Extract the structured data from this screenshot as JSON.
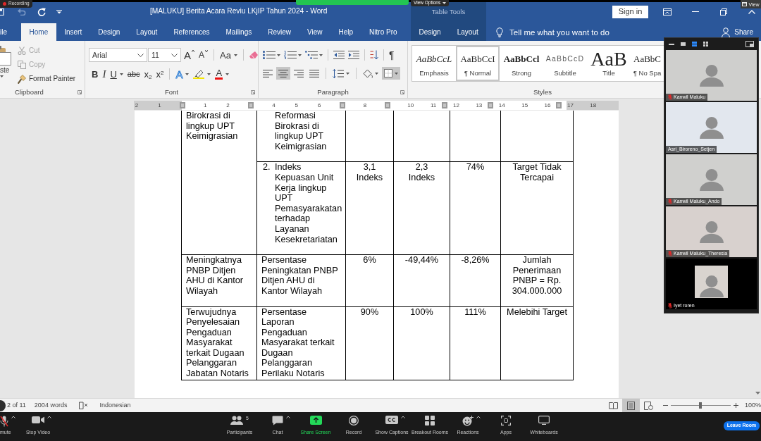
{
  "overlays": {
    "recording": "Recording",
    "view_options": "View Options",
    "view": "View"
  },
  "quick_access": [
    {
      "kind": "save",
      "disabled": false
    },
    {
      "kind": "undo",
      "disabled": true
    },
    {
      "kind": "repeat",
      "disabled": false
    },
    {
      "kind": "customize",
      "disabled": false
    }
  ],
  "title_bar": {
    "title": "[MALUKU] Berita Acara Reviu LKjIP Tahun 2024 - Word",
    "context_label": "Table Tools",
    "sign_in": "Sign in"
  },
  "tabs": [
    {
      "label": "ile",
      "kind": "file",
      "selected": false
    },
    {
      "label": "Home",
      "kind": "main",
      "selected": true
    },
    {
      "label": "Insert",
      "kind": "main",
      "selected": false
    },
    {
      "label": "Design",
      "kind": "main",
      "selected": false
    },
    {
      "label": "Layout",
      "kind": "main",
      "selected": false
    },
    {
      "label": "References",
      "kind": "main",
      "selected": false
    },
    {
      "label": "Mailings",
      "kind": "main",
      "selected": false
    },
    {
      "label": "Review",
      "kind": "main",
      "selected": false
    },
    {
      "label": "View",
      "kind": "main",
      "selected": false
    },
    {
      "label": "Help",
      "kind": "main",
      "selected": false
    },
    {
      "label": "Nitro Pro",
      "kind": "main",
      "selected": false
    },
    {
      "label": "Design",
      "kind": "context",
      "selected": false
    },
    {
      "label": "Layout",
      "kind": "context",
      "selected": false
    }
  ],
  "tell_me": {
    "placeholder": "Tell me what you want to do"
  },
  "share": "Share",
  "ribbon": {
    "clipboard": {
      "label": "Clipboard",
      "paste": "ste",
      "actions": [
        {
          "kind": "cut",
          "label": "Cut",
          "disabled": true
        },
        {
          "kind": "copy",
          "label": "Copy",
          "disabled": true
        },
        {
          "kind": "format-painter",
          "label": "Format Painter",
          "disabled": false
        }
      ]
    },
    "font": {
      "label": "Font",
      "font_name": "Arial",
      "font_size": "11",
      "row_1": [
        {
          "kind": "grow",
          "glyph": "A",
          "menu": false
        },
        {
          "kind": "shrink",
          "glyph": "A",
          "menu": false
        },
        {
          "kind": "case",
          "glyph": "Aa",
          "menu": true
        },
        {
          "kind": "clear",
          "menu": false
        }
      ],
      "row_2": [
        {
          "kind": "bold",
          "glyph": "B",
          "menu": false
        },
        {
          "kind": "italic",
          "glyph": "I",
          "menu": false
        },
        {
          "kind": "underline",
          "glyph": "U",
          "menu": true
        },
        {
          "kind": "strike",
          "glyph": "abc",
          "menu": false
        },
        {
          "kind": "subscript",
          "glyph": "x$_{2}$",
          "menu": false
        },
        {
          "kind": "superscript",
          "glyph": "x$^{2}$",
          "menu": false
        },
        {
          "kind": "effects",
          "glyph": "A",
          "menu": true
        },
        {
          "kind": "highlight",
          "menu": true
        },
        {
          "kind": "color",
          "glyph": "A",
          "menu": true
        }
      ]
    },
    "paragraph": {
      "label": "Paragraph",
      "row_1": [
        {
          "kind": "bullets",
          "menu": true
        },
        {
          "kind": "numbering",
          "menu": true
        },
        {
          "kind": "multilevel",
          "menu": true
        },
        {
          "kind": "outdent",
          "menu": false
        },
        {
          "kind": "indent",
          "menu": false
        },
        {
          "kind": "sort",
          "menu": false
        },
        {
          "kind": "pilcrow",
          "glyph": "¶",
          "menu": false
        }
      ],
      "row_2": [
        {
          "kind": "align-left",
          "selected": false,
          "menu": false
        },
        {
          "kind": "align-center",
          "selected": true,
          "menu": false
        },
        {
          "kind": "align-right",
          "selected": false,
          "menu": false
        },
        {
          "kind": "justify",
          "selected": false,
          "menu": false
        },
        {
          "kind": "line-spacing",
          "selected": false,
          "menu": true
        },
        {
          "kind": "shading",
          "selected": false,
          "menu": true
        },
        {
          "kind": "borders",
          "selected": true,
          "menu": true
        }
      ]
    },
    "styles": {
      "label": "Styles",
      "items": [
        {
          "kind": "emphasis",
          "preview": "AaBbCcL",
          "name": "Emphasis",
          "selected": false
        },
        {
          "kind": "normal",
          "preview": "AaBbCcI",
          "name": "¶ Normal",
          "selected": true
        },
        {
          "kind": "strong",
          "preview": "AaBbCcl",
          "name": "Strong",
          "selected": false
        },
        {
          "kind": "subtitle",
          "preview": "AaBbCcD",
          "name": "Subtitle",
          "selected": false
        },
        {
          "kind": "title",
          "preview": "AaB",
          "name": "Title",
          "selected": false
        },
        {
          "kind": "nospacing",
          "preview": "AaBbC",
          "name": "¶ No Spa",
          "selected": false
        }
      ]
    }
  },
  "ruler": {
    "marks": [
      {
        "kind": "number",
        "text": "2"
      },
      {
        "kind": "number",
        "text": "1"
      },
      {
        "kind": "marker"
      },
      {
        "kind": "number",
        "text": "1"
      },
      {
        "kind": "number",
        "text": "2"
      },
      {
        "kind": "marker"
      },
      {
        "kind": "number",
        "text": "4"
      },
      {
        "kind": "number",
        "text": "5"
      },
      {
        "kind": "number",
        "text": "6"
      },
      {
        "kind": "marker"
      },
      {
        "kind": "number",
        "text": "8"
      },
      {
        "kind": "marker"
      },
      {
        "kind": "number",
        "text": "10"
      },
      {
        "kind": "number",
        "text": "11"
      },
      {
        "kind": "split"
      },
      {
        "kind": "number",
        "text": "12"
      },
      {
        "kind": "number",
        "text": "13"
      },
      {
        "kind": "split"
      },
      {
        "kind": "number",
        "text": "14"
      },
      {
        "kind": "number",
        "text": "15"
      },
      {
        "kind": "number",
        "text": "16"
      },
      {
        "kind": "split"
      },
      {
        "kind": "number",
        "text": "17"
      },
      {
        "kind": "number",
        "text": "18"
      }
    ]
  },
  "document": {
    "rows": [
      {
        "cells": [
          {
            "text": "Birokrasi di\nlingkup UPT\nKeimigrasian",
            "rowspan": 2
          },
          {
            "kind": "list",
            "text": "Reformasi\nBirokrasi di\nlingkup UPT\nKeimigrasian"
          },
          {},
          {},
          {},
          {}
        ]
      },
      {
        "cells": [
          {
            "kind": "list",
            "number": "2.",
            "text": "Indeks\nKepuasan Unit\nKerja lingkup\nUPT\nPemasyarakatan\nterhadap\nLayanan\nKesekretariatan"
          },
          {
            "text": "3,1\nIndeks"
          },
          {
            "text": "2,3\nIndeks"
          },
          {
            "text": "74%"
          },
          {
            "text": "Target Tidak\nTercapai"
          }
        ]
      },
      {
        "cells": [
          {
            "text": "Meningkatnya\nPNBP Ditjen\nAHU di Kantor\nWilayah"
          },
          {
            "text": "Persentase\nPeningkatan PNBP\nDitjen AHU di\nKantor Wilayah"
          },
          {
            "text": "6%"
          },
          {
            "text": "-49,44%"
          },
          {
            "text": "-8,26%"
          },
          {
            "text": "Jumlah\nPenerimaan\nPNBP = Rp.\n304.000.000"
          }
        ]
      },
      {
        "cells": [
          {
            "text": "Terwujudnya\nPenyelesaian\nPengaduan\nMasyarakat\nterkait Dugaan\nPelanggaran\nJabatan Notaris"
          },
          {
            "text": "Persentase\nLaporan\nPengaduan\nMasyarakat terkait\nDugaan\nPelanggaran\nPerilaku Notaris"
          },
          {
            "text": "90%"
          },
          {
            "text": "100%"
          },
          {
            "text": "111%"
          },
          {
            "text": "Melebihi Target"
          }
        ]
      }
    ]
  },
  "status_bar": {
    "page": "2 of 11",
    "words": "2004 words",
    "language": "Indonesian",
    "views": [
      {
        "kind": "read",
        "selected": false
      },
      {
        "kind": "print",
        "selected": true
      },
      {
        "kind": "web",
        "selected": false
      }
    ],
    "zoom_slider": {
      "level": 0.5
    },
    "zoom": "100%"
  },
  "video_panel": {
    "view_modes": [
      {
        "kind": "minimize",
        "selected": false
      },
      {
        "kind": "single",
        "selected": false
      },
      {
        "kind": "list",
        "selected": true
      },
      {
        "kind": "grid",
        "selected": false
      }
    ],
    "participants": [
      {
        "name": "Kanwil Maluku",
        "muted": true,
        "kind": "video"
      },
      {
        "name": "Asri_Biroreno_Setjen",
        "muted": false,
        "kind": "video"
      },
      {
        "name": "Kanwil Maluku_Ando",
        "muted": true,
        "kind": "video"
      },
      {
        "name": "Kanwil Maluku_Theresia",
        "muted": true,
        "kind": "video"
      },
      {
        "name": "Iyet roren",
        "muted": true,
        "kind": "inset"
      }
    ]
  },
  "meeting_toolbar": {
    "items": [
      {
        "kind": "mic",
        "label": "mute",
        "menu": true
      },
      {
        "kind": "video",
        "label": "Stop Video",
        "menu": true
      },
      {
        "kind": "participants",
        "label": "Participants",
        "count": "5",
        "menu": false
      },
      {
        "kind": "chat",
        "label": "Chat",
        "menu": true
      },
      {
        "kind": "share",
        "label": "Share Screen",
        "menu": false
      },
      {
        "kind": "record",
        "label": "Record",
        "menu": false
      },
      {
        "kind": "captions",
        "label": "Show Captions",
        "menu": true
      },
      {
        "kind": "breakout",
        "label": "Breakout Rooms",
        "menu": false
      },
      {
        "kind": "reactions",
        "label": "Reactions",
        "menu": true
      },
      {
        "kind": "apps",
        "label": "Apps",
        "menu": false
      },
      {
        "kind": "whiteboard",
        "label": "Whiteboards",
        "menu": false
      }
    ],
    "leave": "Leave Room"
  }
}
